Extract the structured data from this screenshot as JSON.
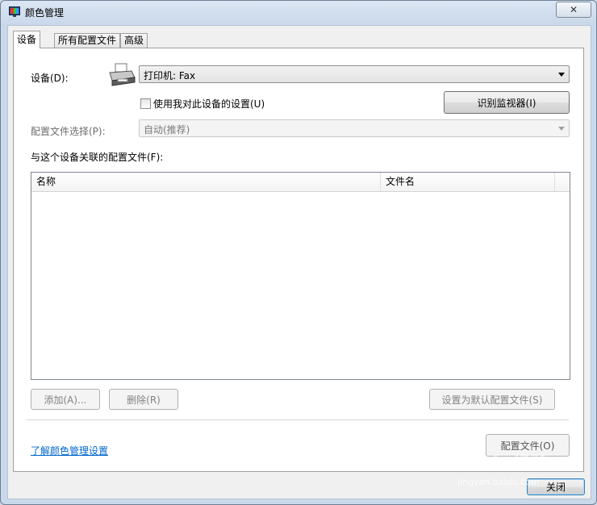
{
  "window": {
    "title": "颜色管理",
    "close_symbol": "✕"
  },
  "tabs": [
    {
      "label": "设备",
      "active": true
    },
    {
      "label": "所有配置文件",
      "active": false
    },
    {
      "label": "高级",
      "active": false
    }
  ],
  "device": {
    "label": "设备(D):",
    "icon": "printer-icon",
    "selected": "打印机: Fax",
    "use_my_settings_label": "使用我对此设备的设置(U)",
    "use_my_settings_checked": false,
    "identify_monitors_button": "识别监视器(I)"
  },
  "profile_selection": {
    "label": "配置文件选择(P):",
    "selected": "自动(推荐)"
  },
  "associated_profiles": {
    "label": "与这个设备关联的配置文件(F):",
    "columns": [
      "名称",
      "文件名"
    ],
    "rows": []
  },
  "buttons": {
    "add": "添加(A)...",
    "remove": "删除(R)",
    "set_default": "设置为默认配置文件(S)",
    "profiles": "配置文件(O)",
    "close": "关闭"
  },
  "link": {
    "learn_more": "了解颜色管理设置"
  },
  "watermark": {
    "brand": "Baidu经验",
    "url": "jingyan.baidu.com"
  }
}
